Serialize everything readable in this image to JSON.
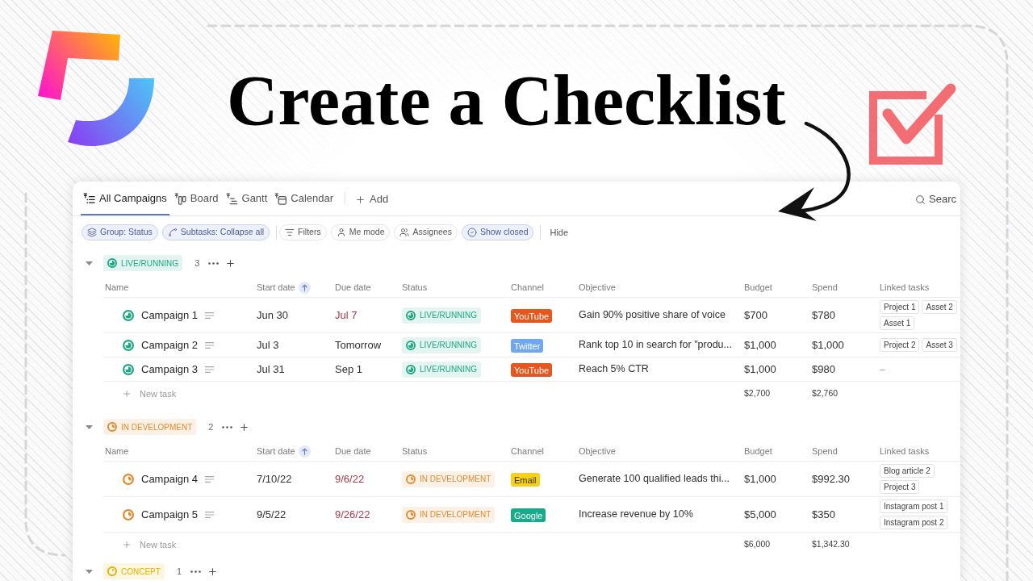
{
  "heading": "Create a Checklist",
  "app": {
    "tabs": [
      {
        "label": "All Campaigns",
        "kind": "list",
        "selected": true
      },
      {
        "label": "Board",
        "kind": "board",
        "selected": false
      },
      {
        "label": "Gantt",
        "kind": "gantt",
        "selected": false
      },
      {
        "label": "Calendar",
        "kind": "calendar",
        "selected": false
      }
    ],
    "add_view": "Add",
    "search": {
      "placeholder": "Searc"
    },
    "toolbar": [
      {
        "label": "Group: Status",
        "kind": "layers",
        "active": true,
        "divider_after": false
      },
      {
        "label": "Subtasks: Collapse all",
        "kind": "subtasks",
        "active": true,
        "divider_after": true
      },
      {
        "label": "Filters",
        "kind": "filter",
        "active": false,
        "divider_after": false
      },
      {
        "label": "Me mode",
        "kind": "person",
        "active": false,
        "divider_after": false
      },
      {
        "label": "Assignees",
        "kind": "people",
        "active": false,
        "divider_after": false
      },
      {
        "label": "Show closed",
        "kind": "check",
        "active": true,
        "divider_after": true
      }
    ],
    "hide": "Hide",
    "groups": [
      {
        "status": "LIVE/RUNNING",
        "kind": "live",
        "color": "#1ea784",
        "count": "3",
        "expanded": true,
        "columns": [
          {
            "label": "Name",
            "sorted": false
          },
          {
            "label": "Start date",
            "sorted": true
          },
          {
            "label": "Due date",
            "sorted": false
          },
          {
            "label": "Status",
            "sorted": false
          },
          {
            "label": "Channel",
            "sorted": false
          },
          {
            "label": "Objective",
            "sorted": false
          },
          {
            "label": "Budget",
            "sorted": false
          },
          {
            "label": "Spend",
            "sorted": false
          },
          {
            "label": "Linked tasks",
            "sorted": false
          }
        ],
        "rows": [
          {
            "name": "Campaign 1",
            "start_date": "Jun 30",
            "due_date": {
              "text": "Jul 7",
              "overdue": true
            },
            "status": "LIVE/RUNNING",
            "channel": {
              "label": "YouTube",
              "color": "#e4581d"
            },
            "objective": "Gain 90% positive share of voice",
            "budget": "$700",
            "spend": "$780",
            "linked_tasks": [
              "Project 1",
              "Asset 2",
              "Asset 1"
            ]
          },
          {
            "name": "Campaign 2",
            "start_date": "Jul 3",
            "due_date": {
              "text": "Tomorrow",
              "overdue": false
            },
            "status": "LIVE/RUNNING",
            "channel": {
              "label": "Twitter",
              "color": "#6fa8f0"
            },
            "objective": "Rank top 10 in search for \"produ...",
            "budget": "$1,000",
            "spend": "$1,000",
            "linked_tasks": [
              "Project 2",
              "Asset 3"
            ]
          },
          {
            "name": "Campaign 3",
            "start_date": "Jul 31",
            "due_date": {
              "text": "Sep 1",
              "overdue": false
            },
            "status": "LIVE/RUNNING",
            "channel": {
              "label": "YouTube",
              "color": "#e4581d"
            },
            "objective": "Reach 5% CTR",
            "budget": "$1,000",
            "spend": "$980",
            "linked_tasks_empty": "–"
          }
        ],
        "new_task": "New task",
        "total_budget": "$2,700",
        "total_spend": "$2,760"
      },
      {
        "status": "IN DEVELOPMENT",
        "kind": "development",
        "color": "#e38a2c",
        "count": "2",
        "expanded": true,
        "columns": [
          {
            "label": "Name",
            "sorted": false
          },
          {
            "label": "Start date",
            "sorted": true
          },
          {
            "label": "Due date",
            "sorted": false
          },
          {
            "label": "Status",
            "sorted": false
          },
          {
            "label": "Channel",
            "sorted": false
          },
          {
            "label": "Objective",
            "sorted": false
          },
          {
            "label": "Budget",
            "sorted": false
          },
          {
            "label": "Spend",
            "sorted": false
          },
          {
            "label": "Linked tasks",
            "sorted": false
          }
        ],
        "rows": [
          {
            "name": "Campaign 4",
            "start_date": "7/10/22",
            "due_date": {
              "text": "9/6/22",
              "overdue": true
            },
            "status": "IN DEVELOPMENT",
            "channel": {
              "label": "Email",
              "color": "#f6d11a"
            },
            "objective": "Generate 100 qualified leads thi...",
            "budget": "$1,000",
            "spend": "$992.30",
            "linked_tasks": [
              "Blog article 2",
              "Project 3"
            ]
          },
          {
            "name": "Campaign 5",
            "start_date": "9/5/22",
            "due_date": {
              "text": "9/26/22",
              "overdue": true
            },
            "status": "IN DEVELOPMENT",
            "channel": {
              "label": "Google",
              "color": "#19a98b"
            },
            "objective": "Increase revenue by 10%",
            "budget": "$5,000",
            "spend": "$350",
            "linked_tasks": [
              "Instagram post 1",
              "Instagram post 2"
            ]
          }
        ],
        "new_task": "New task",
        "total_budget": "$6,000",
        "total_spend": "$1,342.30"
      },
      {
        "status": "CONCEPT",
        "kind": "concept",
        "color": "#e2b100",
        "count": "1",
        "expanded": true
      }
    ]
  }
}
